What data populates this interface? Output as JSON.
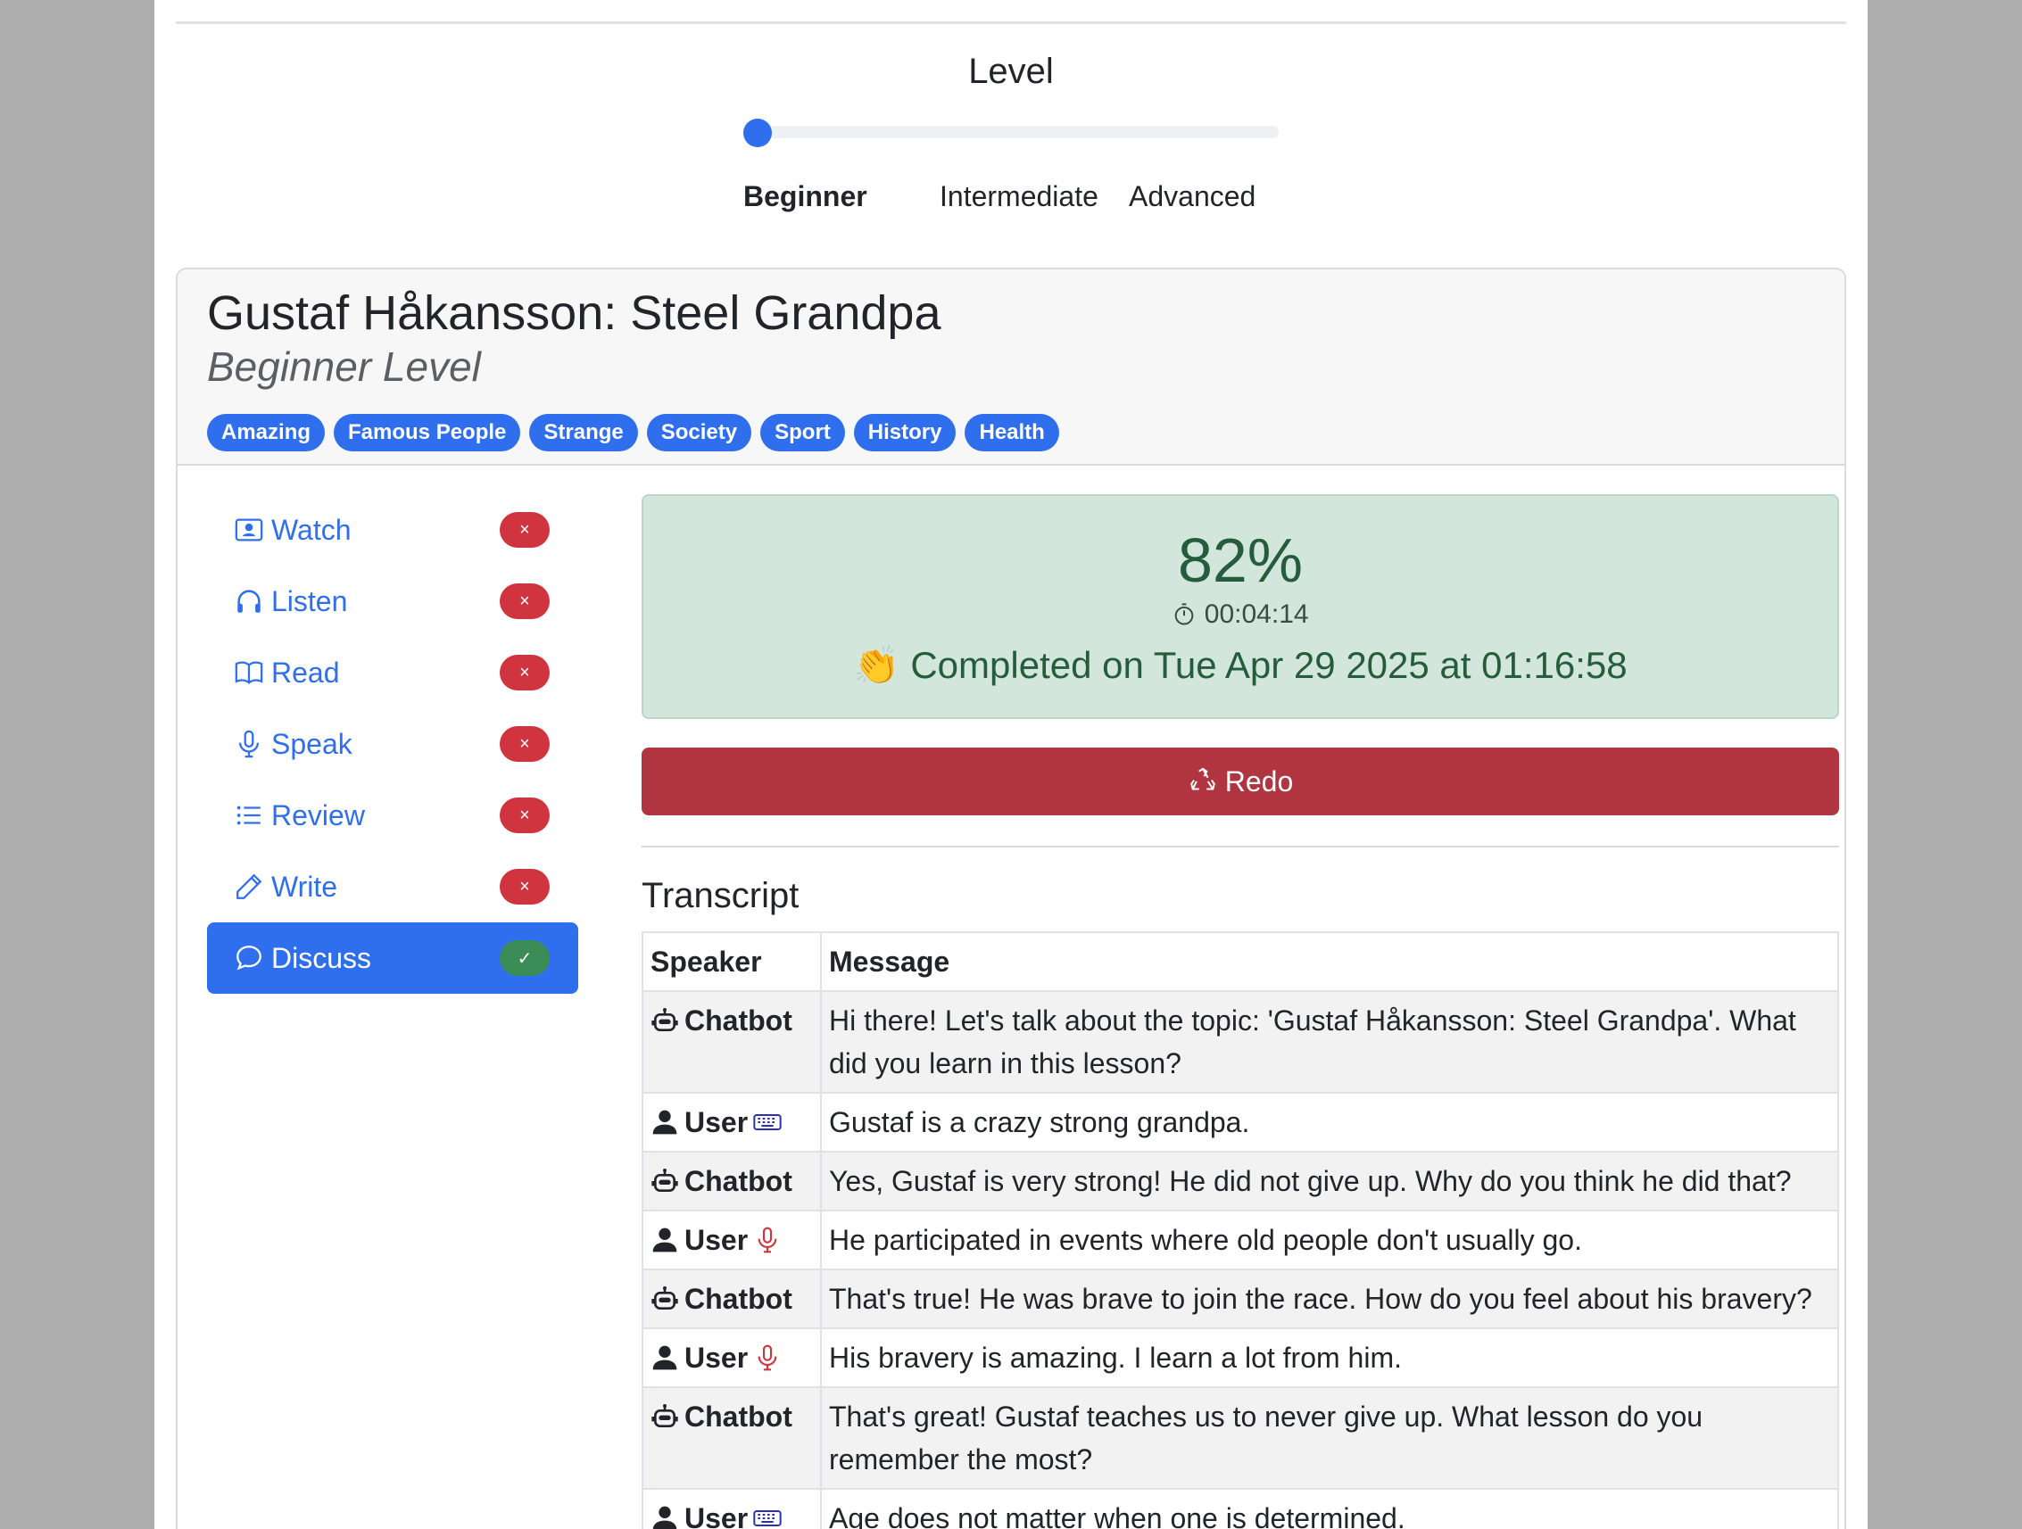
{
  "level": {
    "title": "Level",
    "value": 0,
    "options": [
      "Beginner",
      "Intermediate",
      "Advanced"
    ],
    "selected": "Beginner"
  },
  "lesson": {
    "title": "Gustaf Håkansson: Steel Grandpa",
    "subtitle": "Beginner Level",
    "tags": [
      "Amazing",
      "Famous People",
      "Strange",
      "Society",
      "Sport",
      "History",
      "Health"
    ]
  },
  "nav": {
    "items": [
      {
        "label": "Watch",
        "icon": "video-person-icon",
        "status": "×",
        "complete": false
      },
      {
        "label": "Listen",
        "icon": "headphones-icon",
        "status": "×",
        "complete": false
      },
      {
        "label": "Read",
        "icon": "book-icon",
        "status": "×",
        "complete": false
      },
      {
        "label": "Speak",
        "icon": "microphone-icon",
        "status": "×",
        "complete": false
      },
      {
        "label": "Review",
        "icon": "list-icon",
        "status": "×",
        "complete": false
      },
      {
        "label": "Write",
        "icon": "pencil-icon",
        "status": "×",
        "complete": false
      },
      {
        "label": "Discuss",
        "icon": "chat-icon",
        "status": "✓",
        "complete": true
      }
    ]
  },
  "result": {
    "score": "82%",
    "time": "00:04:14",
    "completed": "👏 Completed on Tue Apr 29 2025 at 01:16:58",
    "redo_label": "Redo"
  },
  "transcript": {
    "title": "Transcript",
    "headers": [
      "Speaker",
      "Message"
    ],
    "rows": [
      {
        "speaker": "Chatbot",
        "input": "",
        "message": "Hi there! Let's talk about the topic: 'Gustaf Håkansson: Steel Grandpa'. What did you learn in this lesson?"
      },
      {
        "speaker": "User",
        "input": "keyboard-icon",
        "message": "Gustaf is a crazy strong grandpa."
      },
      {
        "speaker": "Chatbot",
        "input": "",
        "message": "Yes, Gustaf is very strong! He did not give up. Why do you think he did that?"
      },
      {
        "speaker": "User",
        "input": "microphone-icon",
        "message": "He participated in events where old people don't usually go."
      },
      {
        "speaker": "Chatbot",
        "input": "",
        "message": "That's true! He was brave to join the race. How do you feel about his bravery?"
      },
      {
        "speaker": "User",
        "input": "microphone-icon",
        "message": "His bravery is amazing. I learn a lot from him."
      },
      {
        "speaker": "Chatbot",
        "input": "",
        "message": "That's great! Gustaf teaches us to never give up. What lesson do you remember the most?"
      },
      {
        "speaker": "User",
        "input": "keyboard-icon",
        "message": "Age does not matter when one is determined."
      }
    ]
  },
  "colors": {
    "primary": "#2f6fee",
    "danger": "#d0343e",
    "success": "#3c8c58",
    "redo": "#b03540",
    "score_bg": "#d2e6dc",
    "score_text": "#255c3c"
  }
}
